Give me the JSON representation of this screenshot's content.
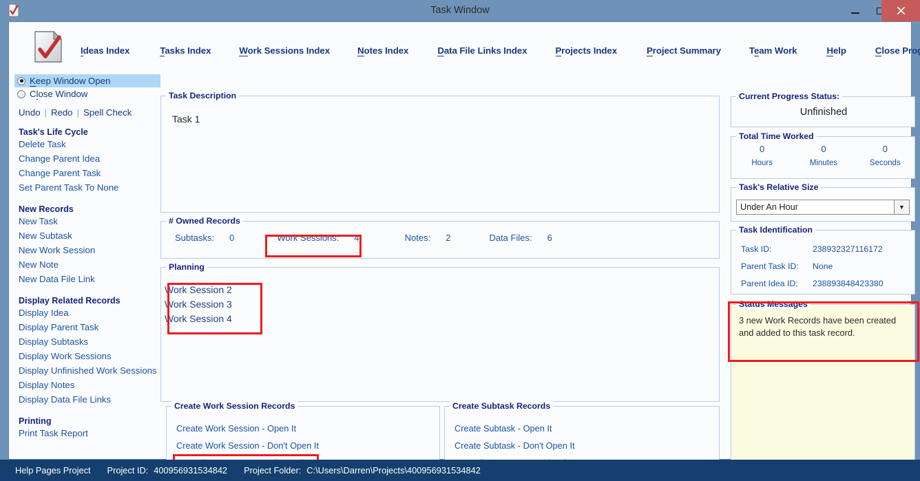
{
  "window": {
    "title": "Task Window",
    "icon": "document-check-icon",
    "controls": {
      "minimize": "–",
      "maximize": "□",
      "close": "✕"
    }
  },
  "nav": {
    "items": [
      {
        "label": "Ideas Index",
        "accel": "I"
      },
      {
        "label": "Tasks Index",
        "accel": "T"
      },
      {
        "label": "Work Sessions Index",
        "accel": "W"
      },
      {
        "label": "Notes Index",
        "accel": "N"
      },
      {
        "label": "Data File Links Index",
        "accel": "D"
      },
      {
        "label": "Projects Index",
        "accel": "P"
      },
      {
        "label": "Project Summary",
        "accel": "P"
      },
      {
        "label": "Team Work",
        "accel": "e"
      },
      {
        "label": "Help",
        "accel": "H"
      },
      {
        "label": "Close Program",
        "accel": "C"
      }
    ]
  },
  "sidebar": {
    "window_mode": {
      "selected": "Keep Window Open",
      "options": [
        {
          "label": "Keep Window Open",
          "accel": "K",
          "selected": true
        },
        {
          "label": "Close Window",
          "accel": "l",
          "selected": false
        }
      ]
    },
    "edit_actions": [
      "Undo",
      "Redo",
      "Spell Check"
    ],
    "groups": [
      {
        "heading": "Task's Life Cycle",
        "items": [
          "Delete Task",
          "Change Parent Idea",
          "Change Parent Task",
          "Set Parent Task To None"
        ]
      },
      {
        "heading": "New Records",
        "items": [
          "New Task",
          "New Subtask",
          "New Work Session",
          "New Note",
          "New Data File Link"
        ]
      },
      {
        "heading": "Display Related Records",
        "items": [
          "Display Idea",
          "Display Parent Task",
          "Display Subtasks",
          "Display Work Sessions",
          "Display Unfinished Work Sessions",
          "Display Notes",
          "Display Data File Links"
        ]
      },
      {
        "heading": "Printing",
        "items": [
          "Print Task Report"
        ]
      }
    ]
  },
  "main": {
    "task_description": {
      "legend": "Task Description",
      "value": "Task 1"
    },
    "owned_records": {
      "legend": "# Owned Records",
      "counts": [
        {
          "label": "Subtasks:",
          "value": "0"
        },
        {
          "label": "Work Sessions:",
          "value": "4"
        },
        {
          "label": "Notes:",
          "value": "2"
        },
        {
          "label": "Data Files:",
          "value": "6"
        }
      ]
    },
    "planning": {
      "legend": "Planning",
      "lines": [
        "Work Session 2",
        "Work Session 3",
        "Work Session 4"
      ]
    },
    "create_work_session": {
      "legend": "Create Work Session Records",
      "actions": [
        "Create Work Session - Open It",
        "Create Work Session - Don't Open It",
        "Turn All Content Into Work Sessions"
      ]
    },
    "create_subtask": {
      "legend": "Create Subtask Records",
      "actions": [
        "Create Subtask - Open It",
        "Create Subtask - Don't Open It",
        "Turn All Content Into Subtasks"
      ]
    }
  },
  "right": {
    "progress": {
      "legend": "Current Progress Status:",
      "value": "Unfinished"
    },
    "time_worked": {
      "legend": "Total Time Worked",
      "cells": [
        {
          "value": "0",
          "unit": "Hours"
        },
        {
          "value": "0",
          "unit": "Minutes"
        },
        {
          "value": "0",
          "unit": "Seconds"
        }
      ]
    },
    "relative_size": {
      "legend": "Task's Relative Size",
      "value": "Under An Hour"
    },
    "identification": {
      "legend": "Task Identification",
      "rows": [
        {
          "label": "Task ID:",
          "value": "238932327116172"
        },
        {
          "label": "Parent Task ID:",
          "value": "None"
        },
        {
          "label": "Parent Idea ID:",
          "value": "238893848423380"
        }
      ]
    },
    "status_messages": {
      "legend": "Status Messages",
      "message": "3 new Work Records have been created and added to this task record."
    }
  },
  "statusbar": {
    "project_name": "Help Pages Project",
    "project_id_label": "Project ID:",
    "project_id": "400956931534842",
    "project_folder_label": "Project Folder:",
    "project_folder": "C:\\Users\\Darren\\Projects\\400956931534842"
  },
  "annotations": {
    "highlight_color": "#ee1c20",
    "boxes": [
      "work-sessions-count",
      "planning-work-sessions",
      "turn-all-content-into-work-sessions",
      "status-messages"
    ]
  }
}
